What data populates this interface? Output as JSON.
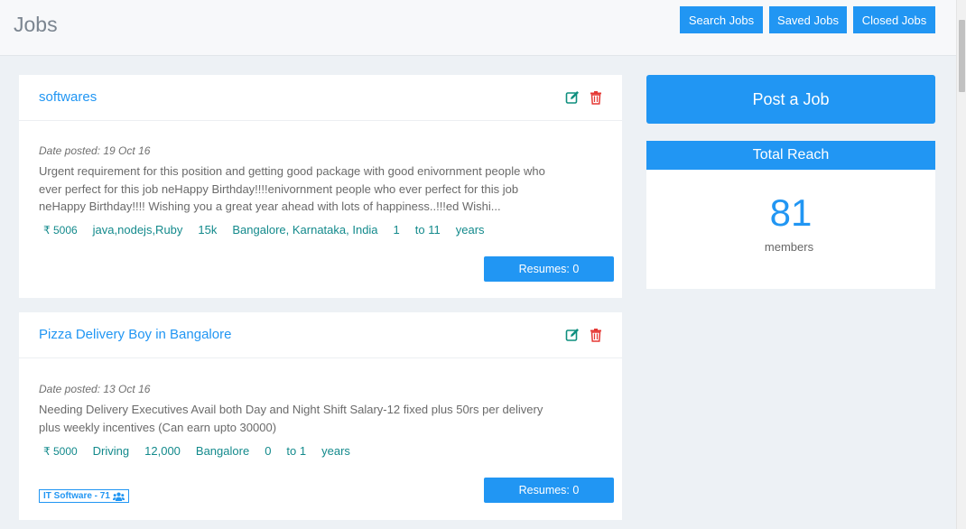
{
  "header": {
    "title": "Jobs",
    "buttons": {
      "search": "Search Jobs",
      "saved": "Saved Jobs",
      "closed": "Closed Jobs"
    }
  },
  "jobs": [
    {
      "title": "softwares",
      "date_posted": "Date posted: 19 Oct 16",
      "description_lines": [
        "Urgent requirement for this position and getting good package with good enivornment people who",
        "ever perfect for this job neHappy Birthday!!!!enivornment people who ever perfect for this job",
        "neHappy Birthday!!!! Wishing you a great year ahead with lots of happiness..!!!ed Wishi..."
      ],
      "salary": "₹ 5006",
      "skills": "java,nodejs,Ruby",
      "package": "15k",
      "location": "Bangalore, Karnataka, India",
      "exp_min": "1",
      "exp_max": "to 11",
      "exp_unit": "years",
      "resumes_label": "Resumes: 0"
    },
    {
      "title": "Pizza Delivery Boy in Bangalore",
      "date_posted": "Date posted: 13 Oct 16",
      "description_lines": [
        "Needing Delivery Executives Avail both Day and Night Shift Salary-12 fixed plus 50rs per delivery",
        "plus weekly incentives (Can earn upto 30000)"
      ],
      "salary": "₹ 5000",
      "skills": "Driving",
      "package": "12,000",
      "location": "Bangalore",
      "exp_min": "0",
      "exp_max": "to 1",
      "exp_unit": "years",
      "resumes_label": "Resumes: 0",
      "tag": "IT Software - 71"
    }
  ],
  "sidebar": {
    "post_job_label": "Post a Job",
    "reach": {
      "title": "Total Reach",
      "count": "81",
      "unit": "members"
    }
  },
  "colors": {
    "accent": "#2196f3",
    "meta_text": "#138a8c",
    "edit_icon": "#0f8f7f",
    "delete_icon": "#e53935"
  },
  "icons": {
    "edit": "edit-icon",
    "delete": "trash-icon",
    "group": "users-icon"
  }
}
